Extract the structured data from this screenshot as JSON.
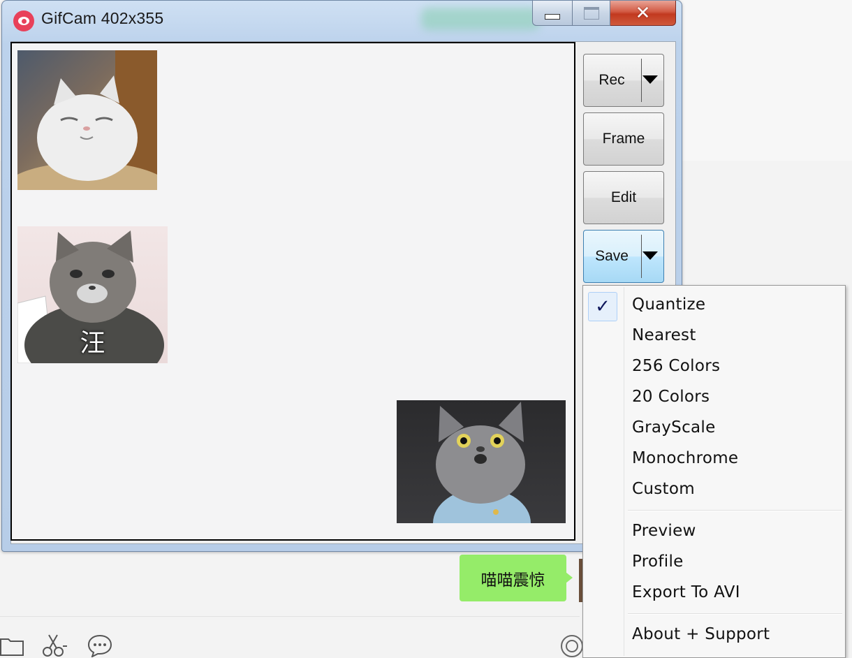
{
  "window": {
    "title": "GifCam 402x355",
    "caption_buttons": {
      "minimize": "minimize",
      "maximize": "maximize",
      "close": "✕"
    }
  },
  "side_buttons": {
    "rec": "Rec",
    "frame": "Frame",
    "edit": "Edit",
    "save": "Save"
  },
  "canvas": {
    "sticker_2_caption": "汪"
  },
  "save_menu": {
    "checked_item": "Quantize",
    "check_glyph": "✓",
    "color_modes": [
      "Quantize",
      "Nearest",
      "256 Colors",
      "20 Colors",
      "GrayScale",
      "Monochrome",
      "Custom"
    ],
    "actions": [
      "Preview",
      "Profile",
      "Export To AVI"
    ],
    "about": "About + Support"
  },
  "chat": {
    "bubble_text": "喵喵震惊",
    "bubble_color": "#95ec69"
  },
  "icons": [
    "folder-icon",
    "scissors-icon",
    "comment-icon",
    "record-icon",
    "dropdown-arrow-icon",
    "checkmark-icon"
  ]
}
